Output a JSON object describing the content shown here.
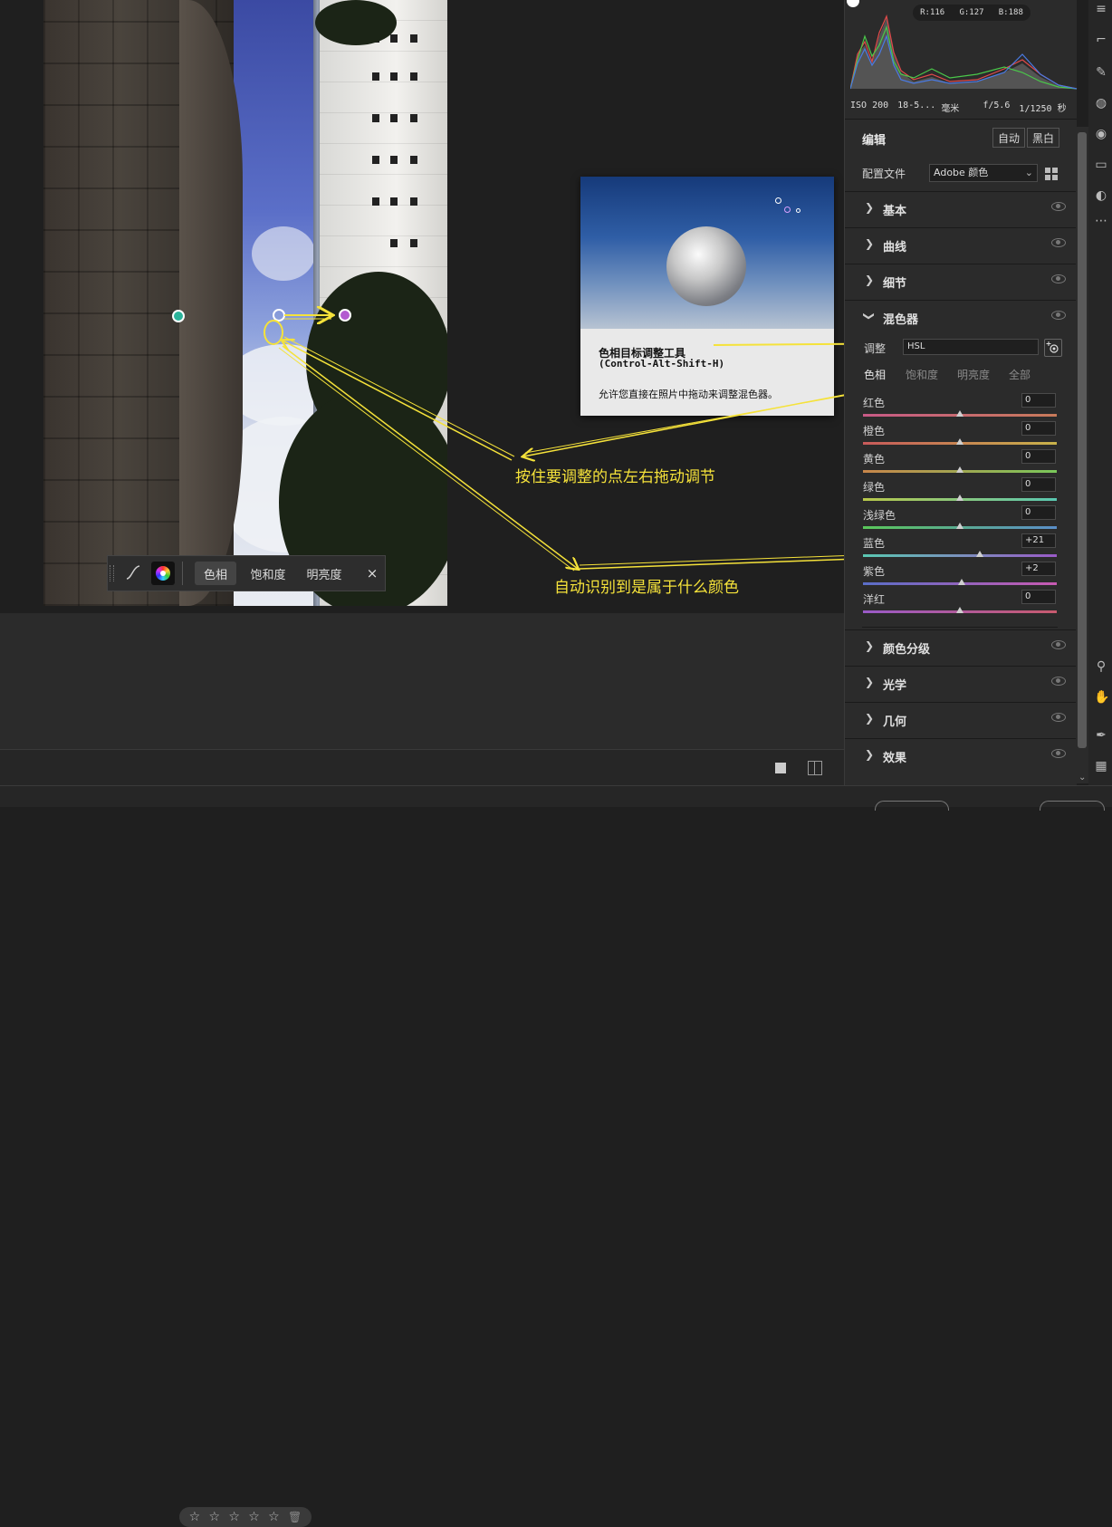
{
  "histogram": {
    "readout": {
      "r": "R:116",
      "g": "G:127",
      "b": "B:188"
    },
    "exif": {
      "iso": "ISO 200",
      "lens": "18-5...",
      "unit": "毫米",
      "aperture": "f/5.6",
      "shutter": "1/1250 秒"
    }
  },
  "edit": {
    "title": "编辑",
    "auto": "自动",
    "bw": "黑白"
  },
  "profile": {
    "label": "配置文件",
    "value": "Adobe 颜色"
  },
  "sections_top": [
    {
      "label": "基本"
    },
    {
      "label": "曲线"
    },
    {
      "label": "细节"
    }
  ],
  "mixer": {
    "label": "混色器",
    "adjust_label": "调整",
    "adjust_value": "HSL",
    "tabs": [
      "色相",
      "饱和度",
      "明亮度",
      "全部"
    ],
    "rows": [
      {
        "name": "红色",
        "value": "0",
        "pos": 0.5,
        "grad": "linear-gradient(90deg,#c85a86,#c87a5a)"
      },
      {
        "name": "橙色",
        "value": "0",
        "pos": 0.5,
        "grad": "linear-gradient(90deg,#c85a5a,#c8b24a)"
      },
      {
        "name": "黄色",
        "value": "0",
        "pos": 0.5,
        "grad": "linear-gradient(90deg,#c8864a,#7ac85a)"
      },
      {
        "name": "绿色",
        "value": "0",
        "pos": 0.5,
        "grad": "linear-gradient(90deg,#b8c84a,#5ac8b2)"
      },
      {
        "name": "浅绿色",
        "value": "0",
        "pos": 0.5,
        "grad": "linear-gradient(90deg,#5ac85a,#5a8ec8)"
      },
      {
        "name": "蓝色",
        "value": "+21",
        "pos": 0.605,
        "grad": "linear-gradient(90deg,#5ac8b2,#9a5ac8)"
      },
      {
        "name": "紫色",
        "value": "+2",
        "pos": 0.51,
        "grad": "linear-gradient(90deg,#5a6ec8,#c85ab2)"
      },
      {
        "name": "洋红",
        "value": "0",
        "pos": 0.5,
        "grad": "linear-gradient(90deg,#9a5ac8,#c85a6e)"
      }
    ]
  },
  "sections_bottom": [
    {
      "label": "颜色分级"
    },
    {
      "label": "光学"
    },
    {
      "label": "几何"
    },
    {
      "label": "效果"
    }
  ],
  "tooltip": {
    "title": "色相目标调整工具",
    "shortcut": "(Control-Alt-Shift-H)",
    "desc": "允许您直接在照片中拖动来调整混色器。"
  },
  "floatbar": {
    "hue": "色相",
    "sat": "饱和度",
    "lum": "明亮度",
    "close": "×"
  },
  "annotations": {
    "drag": "按住要调整的点左右拖动调节",
    "auto": "自动识别到是属于什么颜色"
  },
  "stars": [
    "☆",
    "☆",
    "☆",
    "☆",
    "☆"
  ],
  "pins": {
    "teal": "#2bb39a",
    "purple": "#b35ad0",
    "white": "#ffffff"
  },
  "accent_yellow": "#f5e23a"
}
